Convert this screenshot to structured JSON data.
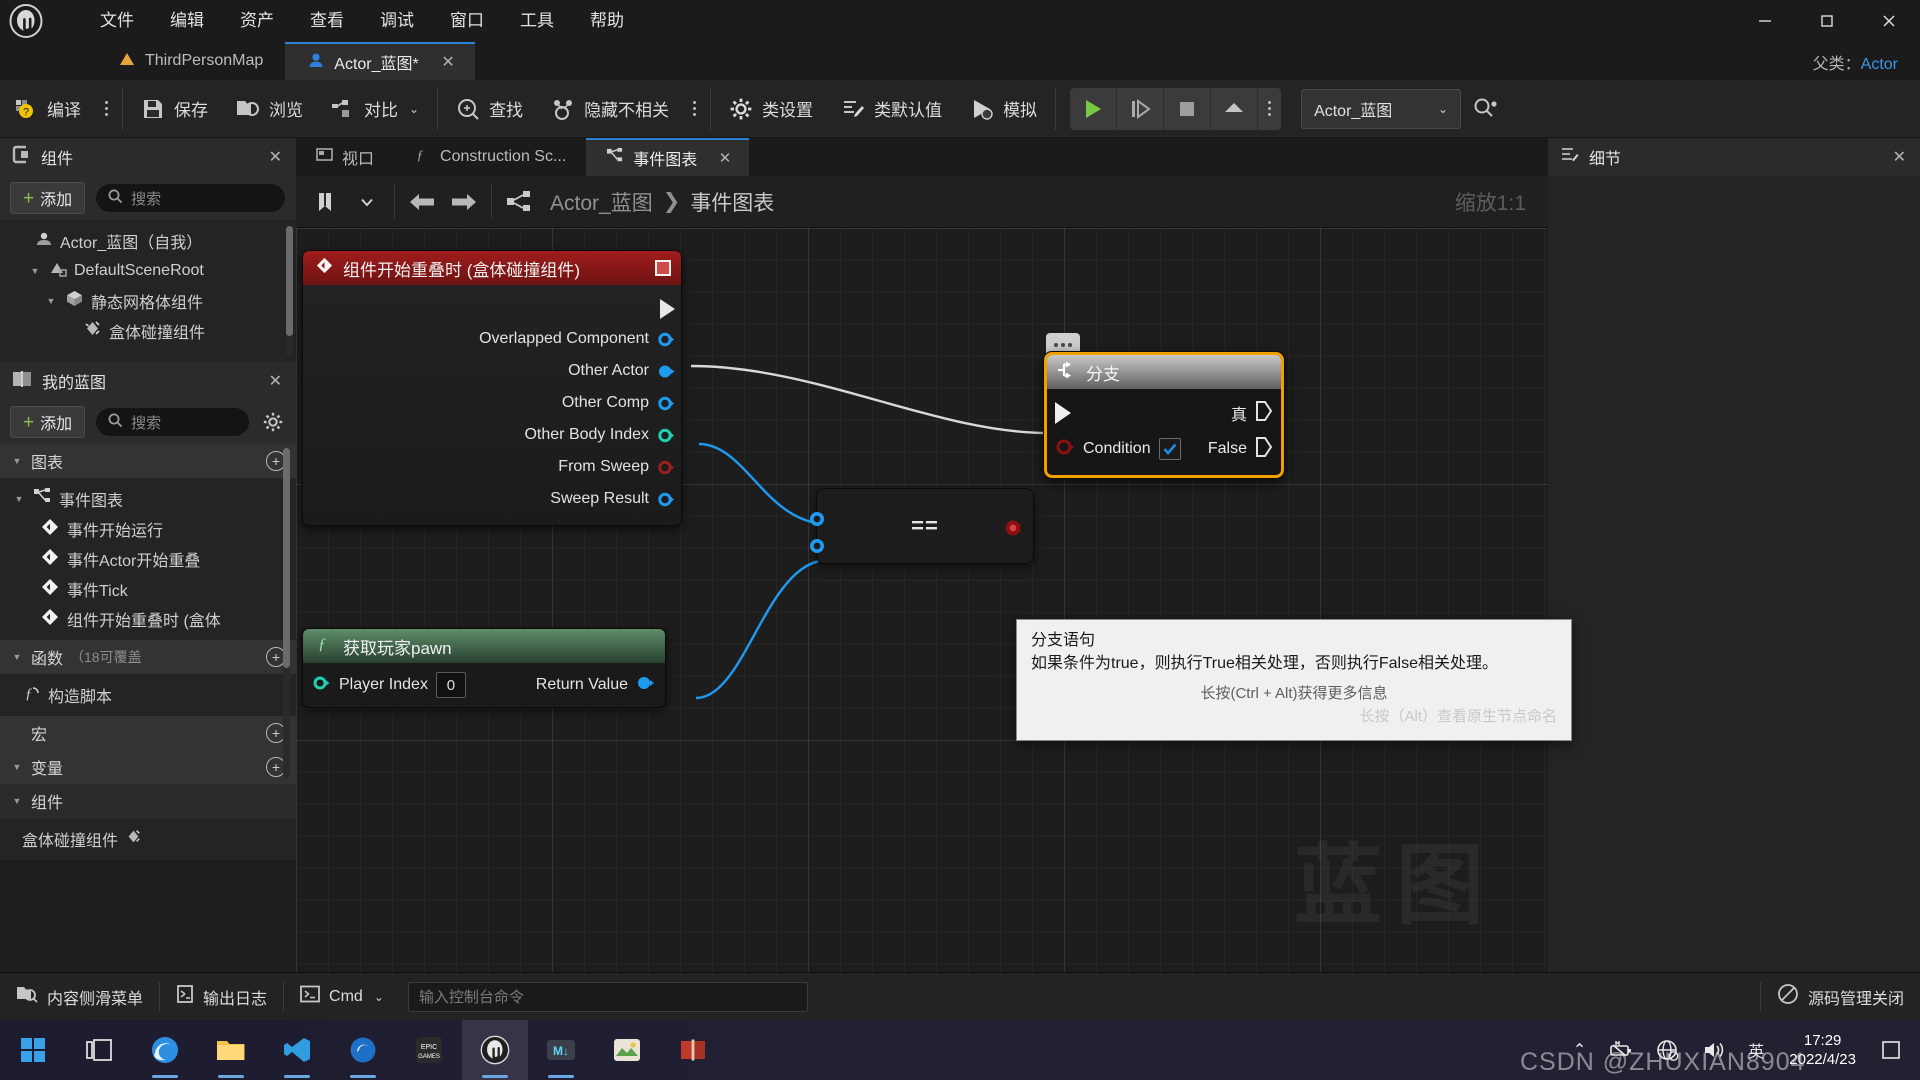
{
  "titlebar": {
    "logo": "unreal-engine-logo",
    "menus": [
      "文件",
      "编辑",
      "资产",
      "查看",
      "调试",
      "窗口",
      "工具",
      "帮助"
    ],
    "window_controls": {
      "minimize": "—",
      "maximize": "❐",
      "close": "✕"
    }
  },
  "tabs": {
    "level_tab": "ThirdPersonMap",
    "blueprint_tab": "Actor_蓝图*",
    "close_glyph": "✕",
    "parent_class_label": "父类：",
    "parent_class_value": "Actor"
  },
  "toolbar": {
    "compile": "编译",
    "save": "保存",
    "browse": "浏览",
    "diff": "对比",
    "find": "查找",
    "hide_unrelated": "隐藏不相关",
    "class_settings": "类设置",
    "class_defaults": "类默认值",
    "simulate": "模拟",
    "blueprint_selector": "Actor_蓝图",
    "play_icons": [
      "play-icon",
      "step-icon",
      "stop-icon",
      "eject-icon"
    ]
  },
  "components_panel": {
    "title": "组件",
    "close": "✕",
    "add_label": "添加",
    "search_placeholder": "搜索",
    "tree": [
      {
        "label": "Actor_蓝图（自我）",
        "icon": "actor-icon",
        "indent": 0,
        "twisty": ""
      },
      {
        "label": "DefaultSceneRoot",
        "icon": "scene-root-icon",
        "indent": 1,
        "twisty": "▼"
      },
      {
        "label": "静态网格体组件",
        "icon": "static-mesh-icon",
        "indent": 2,
        "twisty": "▼"
      },
      {
        "label": "盒体碰撞组件",
        "icon": "box-collision-icon",
        "indent": 3,
        "twisty": ""
      }
    ]
  },
  "my_blueprint_panel": {
    "title": "我的蓝图",
    "close": "✕",
    "add_label": "添加",
    "search_placeholder": "搜索",
    "settings_icon": "gear-icon",
    "sections": [
      {
        "label": "图表",
        "plus": "+",
        "items": [
          {
            "label": "事件图表",
            "icon": "event-graph-icon",
            "indent": 1,
            "twisty": "▼"
          },
          {
            "label": "事件开始运行",
            "icon": "event-node-icon",
            "indent": 2,
            "twisty": ""
          },
          {
            "label": "事件Actor开始重叠",
            "icon": "event-node-icon",
            "indent": 2,
            "twisty": ""
          },
          {
            "label": "事件Tick",
            "icon": "event-node-icon",
            "indent": 2,
            "twisty": ""
          },
          {
            "label": "组件开始重叠时 (盒体",
            "icon": "event-node-icon",
            "indent": 2,
            "twisty": ""
          }
        ]
      },
      {
        "label": "函数",
        "count": "（18可覆盖",
        "plus": "+",
        "items": [
          {
            "label": "构造脚本",
            "icon": "function-icon",
            "indent": 1,
            "twisty": ""
          }
        ]
      },
      {
        "label": "宏",
        "plus": "+",
        "items": []
      },
      {
        "label": "变量",
        "plus": "+",
        "items": []
      },
      {
        "label": "组件",
        "plus": "",
        "items": [
          {
            "label": "盒体碰撞组件",
            "icon": "box-collision-icon",
            "indent": 1,
            "twisty": ""
          }
        ]
      }
    ]
  },
  "graph": {
    "tabs": [
      {
        "label": "视口",
        "icon": "viewport-icon",
        "active": false
      },
      {
        "label": "Construction Sc...",
        "icon": "function-icon",
        "active": false
      },
      {
        "label": "事件图表",
        "icon": "event-graph-icon",
        "active": true,
        "close": "✕"
      }
    ],
    "toolbar_icons": [
      "bookmark-icon",
      "chevron-down-icon",
      "back-arrow-icon",
      "forward-arrow-icon",
      "event-graph-icon"
    ],
    "breadcrumb": [
      "Actor_蓝图",
      "事件图表"
    ],
    "breadcrumb_sep": "❯",
    "zoom_label": "缩放1:1",
    "watermark": "蓝图"
  },
  "nodes": {
    "event_node": {
      "title": "组件开始重叠时 (盒体碰撞组件)",
      "pins": [
        {
          "label": "Overlapped Component",
          "pin": "object-pin"
        },
        {
          "label": "Other Actor",
          "pin": "object-pin-filled"
        },
        {
          "label": "Other Comp",
          "pin": "object-pin"
        },
        {
          "label": "Other Body Index",
          "pin": "int-pin"
        },
        {
          "label": "From Sweep",
          "pin": "bool-pin"
        },
        {
          "label": "Sweep Result",
          "pin": "struct-pin"
        }
      ]
    },
    "branch_node": {
      "title": "分支",
      "exec_in": "",
      "true_label": "真",
      "false_label": "False",
      "condition_label": "Condition",
      "condition_checked": true
    },
    "equals_node": {
      "label": "=="
    },
    "get_player_pawn_node": {
      "title": "获取玩家pawn",
      "input_label": "Player Index",
      "input_value": "0",
      "output_label": "Return Value"
    }
  },
  "tooltip": {
    "line1": "分支语句",
    "line2": "如果条件为true，则执行True相关处理，否则执行False相关处理。",
    "line3": "长按(Ctrl + Alt)获得更多信息",
    "line4": "长按（Alt）查看原生节点命名"
  },
  "details_panel": {
    "title": "细节",
    "close": "✕"
  },
  "statusbar": {
    "content_drawer": "内容侧滑菜单",
    "output_log": "输出日志",
    "cmd_label": "Cmd",
    "cmd_placeholder": "输入控制台命令",
    "source_control": "源码管理关闭"
  },
  "taskbar": {
    "start_icon": "windows-start-icon",
    "apps": [
      "task-view-icon",
      "edge-icon",
      "file-explorer-icon",
      "vscode-icon",
      "unknown-blue-icon",
      "epic-games-icon",
      "unreal-engine-icon",
      "markdown-icon",
      "app-green-icon",
      "book-icon"
    ],
    "tray": {
      "chevron": "⌃",
      "icons": [
        "battery-icon",
        "network-icon",
        "volume-icon"
      ],
      "ime": "英",
      "time": "17:29",
      "date": "2022/4/23"
    }
  },
  "watermark": "CSDN @ZHUXIAN8904"
}
